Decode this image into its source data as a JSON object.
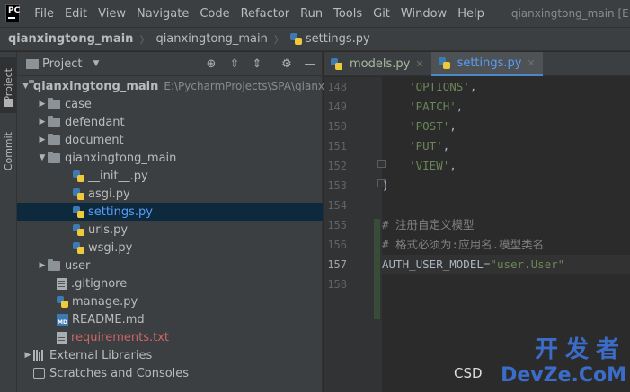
{
  "menubar": {
    "logo_text": "PC",
    "items": [
      "File",
      "Edit",
      "View",
      "Navigate",
      "Code",
      "Refactor",
      "Run",
      "Tools",
      "Git",
      "Window",
      "Help"
    ],
    "window_title": "qianxingtong_main [E:\\Pych"
  },
  "breadcrumb": {
    "items": [
      "qianxingtong_main",
      "qianxingtong_main",
      "settings.py"
    ]
  },
  "toolstrip": {
    "project_label": "Project",
    "commit_label": "Commit"
  },
  "project_panel": {
    "title": "Project",
    "root": {
      "name": "qianxingtong_main",
      "path": "E:\\PycharmProjects\\SPA\\qianx"
    },
    "items": [
      {
        "name": "case"
      },
      {
        "name": "defendant"
      },
      {
        "name": "document"
      },
      {
        "name": "qianxingtong_main"
      },
      {
        "name": "__init__.py"
      },
      {
        "name": "asgi.py"
      },
      {
        "name": "settings.py"
      },
      {
        "name": "urls.py"
      },
      {
        "name": "wsgi.py"
      },
      {
        "name": "user"
      },
      {
        "name": ".gitignore"
      },
      {
        "name": "manage.py"
      },
      {
        "name": "README.md"
      },
      {
        "name": "requirements.txt"
      },
      {
        "name": "External Libraries"
      },
      {
        "name": "Scratches and Consoles"
      }
    ]
  },
  "editor": {
    "tabs": [
      {
        "label": "models.py",
        "active": false
      },
      {
        "label": "settings.py",
        "active": true
      }
    ],
    "current_line": 157,
    "lines": [
      {
        "num": "148",
        "text": "    'OPTIONS',"
      },
      {
        "num": "149",
        "text": "    'PATCH',"
      },
      {
        "num": "150",
        "text": "    'POST',"
      },
      {
        "num": "151",
        "text": "    'PUT',"
      },
      {
        "num": "152",
        "text": "    'VIEW',"
      },
      {
        "num": "153",
        "text": ")"
      },
      {
        "num": "154",
        "text": ""
      },
      {
        "num": "155",
        "text": "# 注册自定义模型"
      },
      {
        "num": "156",
        "text": "# 格式必须为:应用名.模型类名"
      },
      {
        "num": "157",
        "text": "AUTH_USER_MODEL=\"user.User\""
      },
      {
        "num": "158",
        "text": ""
      }
    ],
    "code_tokens": {
      "l148": "'OPTIONS'",
      "l149": "'PATCH'",
      "l150": "'POST'",
      "l151": "'PUT'",
      "l152": "'VIEW'",
      "l153": ")",
      "l155": "# 注册自定义模型",
      "l156": "# 格式必须为:应用名.模型类名",
      "l157_name": "AUTH_USER_MODEL",
      "l157_eq": "=",
      "l157_val": "\"user.User\""
    }
  },
  "watermark": {
    "top": "开发者",
    "bottom": "DevZe.CoM",
    "left": "CSD"
  },
  "colors": {
    "string": "#6a8759",
    "comment": "#808080",
    "selection": "#0d293e",
    "accent": "#4a88c7",
    "ignored_file": "#cc6666"
  }
}
